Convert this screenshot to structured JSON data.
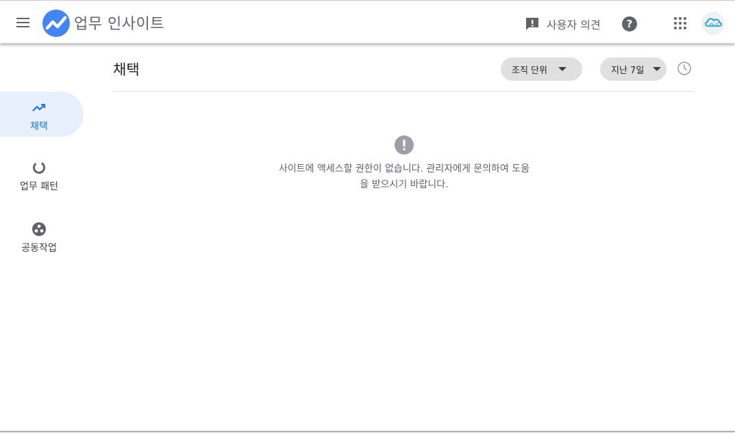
{
  "header": {
    "app_title": "업무 인사이트",
    "feedback_label": "사용자 의견",
    "help_symbol": "?"
  },
  "sidebar": {
    "items": [
      {
        "label": "채택",
        "icon": "trending-up-icon",
        "active": true
      },
      {
        "label": "업무 패턴",
        "icon": "donut-chart-icon",
        "active": false
      },
      {
        "label": "공동작업",
        "icon": "group-circle-icon",
        "active": false
      }
    ]
  },
  "main": {
    "title": "채택",
    "filters": {
      "org_unit_label": "조직 단위",
      "period_label": "지난 7일"
    },
    "error": {
      "line1": "사이트에 액세스할 권한이 없습니다. 관리자에게 문의하여 도움",
      "line2": "을 받으시기 바랍니다."
    }
  },
  "colors": {
    "accent": "#1a73e8",
    "logo_blue": "#4285f4",
    "active_nav_bg": "#e8f0fe",
    "chip_bg": "#e0e0e0",
    "icon_gray": "#5f6368",
    "error_icon": "#9aa0a6"
  }
}
